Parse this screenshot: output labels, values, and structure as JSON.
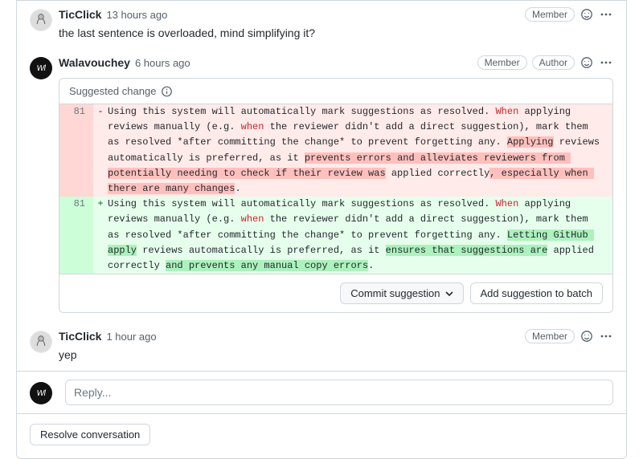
{
  "comments": [
    {
      "author": "TicClick",
      "ts": "13 hours ago",
      "badges": [
        "Member"
      ],
      "text": "the last sentence is overloaded, mind simplifying it?"
    },
    {
      "author": "Walavouchey",
      "ts": "6 hours ago",
      "badges": [
        "Member",
        "Author"
      ],
      "text": ""
    },
    {
      "author": "TicClick",
      "ts": "1 hour ago",
      "badges": [
        "Member"
      ],
      "text": "yep"
    }
  ],
  "suggestion": {
    "label": "Suggested change",
    "line_del": "81",
    "line_add": "81",
    "commit_label": "Commit suggestion",
    "batch_label": "Add suggestion to batch",
    "del_parts": [
      {
        "t": "Using this system will automatically mark suggestions as resolved. "
      },
      {
        "t": "When",
        "cls": "kw"
      },
      {
        "t": " applying reviews manually (e.g. "
      },
      {
        "t": "when",
        "cls": "kw"
      },
      {
        "t": " the reviewer didn't add a direct suggestion), mark them as resolved *after committing the change* to prevent forgetting any. "
      },
      {
        "t": "Applying",
        "cls": "wdel"
      },
      {
        "t": " reviews automatically is preferred, as it "
      },
      {
        "t": "prevents errors and alleviates reviewers from potentially needing to check if their review was",
        "cls": "wdel"
      },
      {
        "t": " applied correctly"
      },
      {
        "t": ", especially when there are many changes",
        "cls": "wdel"
      },
      {
        "t": "."
      }
    ],
    "add_parts": [
      {
        "t": "Using this system will automatically mark suggestions as resolved. "
      },
      {
        "t": "When",
        "cls": "kw"
      },
      {
        "t": " applying reviews manually (e.g. "
      },
      {
        "t": "when",
        "cls": "kw"
      },
      {
        "t": " the reviewer didn't add a direct suggestion), mark them as resolved *after committing the change* to prevent forgetting any. "
      },
      {
        "t": "Letting GitHub apply",
        "cls": "wadd"
      },
      {
        "t": " reviews automatically is preferred, as it "
      },
      {
        "t": "ensures that suggestions are",
        "cls": "wadd"
      },
      {
        "t": " applied correctly "
      },
      {
        "t": "and prevents any manual copy errors",
        "cls": "wadd"
      },
      {
        "t": "."
      }
    ]
  },
  "reply_placeholder": "Reply...",
  "resolve_label": "Resolve conversation"
}
